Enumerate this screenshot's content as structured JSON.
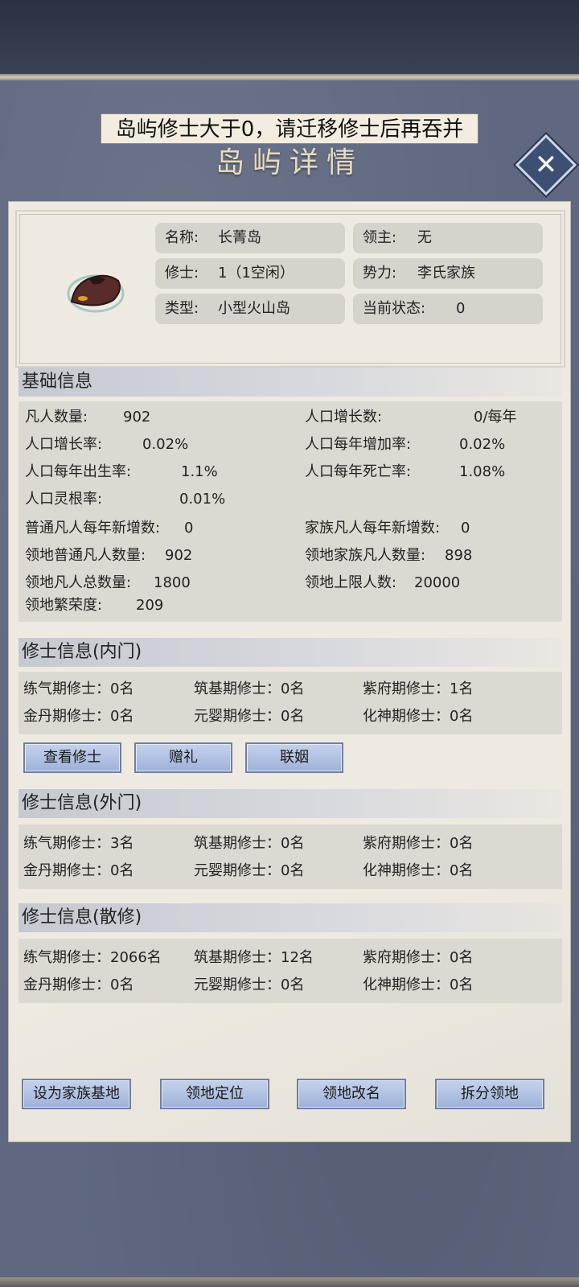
{
  "toast": "岛屿修士大于0，请迁移修士后再吞并",
  "title": "岛屿详情",
  "close": "✕",
  "island": {
    "name_label": "名称:",
    "name": "长菁岛",
    "lord_label": "领主:",
    "lord": "无",
    "cultivators_label": "修士:",
    "cultivators": "1（1空闲）",
    "faction_label": "势力:",
    "faction": "李氏家族",
    "type_label": "类型:",
    "type": "小型火山岛",
    "status_label": "当前状态:",
    "status": "0"
  },
  "basic": {
    "title": "基础信息",
    "items": [
      {
        "label": "凡人数量:",
        "value": "902"
      },
      {
        "label": "人口增长数:",
        "value": "0/每年"
      },
      {
        "label": "人口增长率:",
        "value": "0.02%"
      },
      {
        "label": "人口每年增加率:",
        "value": "0.02%"
      },
      {
        "label": "人口每年出生率:",
        "value": "1.1%"
      },
      {
        "label": "人口每年死亡率:",
        "value": "1.08%"
      },
      {
        "label": "人口灵根率:",
        "value": "0.01%"
      },
      {
        "label": "普通凡人每年新增数:",
        "value": "0"
      },
      {
        "label": "家族凡人每年新增数:",
        "value": "0"
      },
      {
        "label": "领地普通凡人数量:",
        "value": "902"
      },
      {
        "label": "领地家族凡人数量:",
        "value": "898"
      },
      {
        "label": "领地凡人总数量:",
        "value": "1800"
      },
      {
        "label": "领地上限人数:",
        "value": "20000"
      },
      {
        "label": "领地繁荣度:",
        "value": "209"
      }
    ]
  },
  "inner": {
    "title": "修士信息(内门)",
    "items": [
      "练气期修士：0名",
      "筑基期修士：0名",
      "紫府期修士：1名",
      "金丹期修士：0名",
      "元婴期修士：0名",
      "化神期修士：0名"
    ],
    "buttons": [
      "查看修士",
      "赠礼",
      "联姻"
    ]
  },
  "outer": {
    "title": "修士信息(外门)",
    "items": [
      "练气期修士：3名",
      "筑基期修士：0名",
      "紫府期修士：0名",
      "金丹期修士：0名",
      "元婴期修士：0名",
      "化神期修士：0名"
    ]
  },
  "loose": {
    "title": "修士信息(散修)",
    "items": [
      "练气期修士：2066名",
      "筑基期修士：12名",
      "紫府期修士：0名",
      "金丹期修士：0名",
      "元婴期修士：0名",
      "化神期修士：0名"
    ]
  },
  "actions": [
    "设为家族基地",
    "领地定位",
    "领地改名",
    "拆分领地"
  ],
  "colors": {
    "panel": "#efeae1",
    "button": "#a9bbdf",
    "backdrop": "#5f6880"
  }
}
